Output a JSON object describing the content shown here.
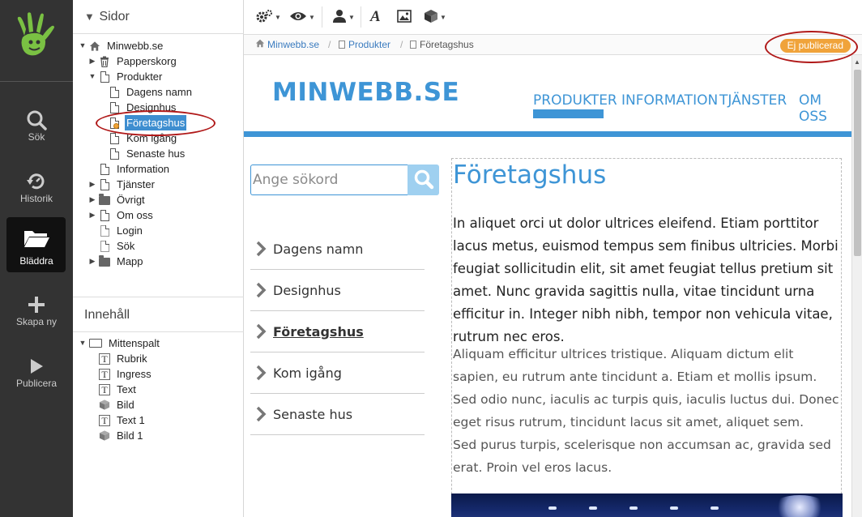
{
  "rail": {
    "items": [
      {
        "label": "Sök",
        "icon": "search-icon"
      },
      {
        "label": "Historik",
        "icon": "history-icon"
      },
      {
        "label": "Bläddra",
        "icon": "folder-open-icon"
      },
      {
        "label": "Skapa ny",
        "icon": "plus-icon"
      },
      {
        "label": "Publicera",
        "icon": "play-icon"
      }
    ]
  },
  "pages_panel": {
    "title": "Sidor",
    "tree": [
      {
        "label": "Minwebb.se"
      },
      {
        "label": "Papperskorg"
      },
      {
        "label": "Produkter"
      },
      {
        "label": "Dagens namn"
      },
      {
        "label": "Designhus"
      },
      {
        "label": "Företagshus"
      },
      {
        "label": "Kom igång"
      },
      {
        "label": "Senaste hus"
      },
      {
        "label": "Information"
      },
      {
        "label": "Tjänster"
      },
      {
        "label": "Övrigt"
      },
      {
        "label": "Om oss"
      },
      {
        "label": "Login"
      },
      {
        "label": "Sök"
      },
      {
        "label": "Mapp"
      }
    ]
  },
  "content_panel": {
    "title": "Innehåll",
    "tree": [
      {
        "label": "Mittenspalt"
      },
      {
        "label": "Rubrik"
      },
      {
        "label": "Ingress"
      },
      {
        "label": "Text"
      },
      {
        "label": "Bild"
      },
      {
        "label": "Text 1"
      },
      {
        "label": "Bild 1"
      }
    ]
  },
  "toolbar": {
    "icons": [
      "gears-icon",
      "eye-icon",
      "user-icon",
      "font-icon",
      "image-icon",
      "cube-icon"
    ]
  },
  "breadcrumb": {
    "items": [
      "Minwebb.se",
      "Produkter",
      "Företagshus"
    ],
    "separator": "/"
  },
  "status_badge": "Ej publicerad",
  "site": {
    "logo": "MINWEBB.SE",
    "nav": [
      "PRODUKTER",
      "INFORMATION",
      "TJÄNSTER",
      "OM OSS"
    ],
    "search_placeholder": "Ange sökord",
    "side_links": [
      "Dagens namn",
      "Designhus",
      "Företagshus",
      "Kom igång",
      "Senaste hus"
    ],
    "title": "Företagshus",
    "ingress": "In aliquet orci ut dolor ultrices eleifend. Etiam porttitor lacus metus, euismod tempus sem finibus ultricies. Morbi feugiat sollicitudin elit, sit amet feugiat tellus pretium sit amet. Nunc gravida sagittis nulla, vitae tincidunt urna efficitur in. Integer nibh nibh, tempor non vehicula vitae, rutrum nec eros.",
    "body_1": "Aliquam efficitur ultrices tristique. Aliquam dictum elit sapien, eu rutrum ante tincidunt a. Etiam et mollis ipsum. Sed odio nunc, iaculis ac turpis quis, iaculis luctus dui. Donec eget risus rutrum, tincidunt lacus sit amet, aliquet sem.",
    "body_2": "Sed purus turpis, scelerisque non accumsan ac, gravida sed erat. Proin vel eros lacus."
  },
  "colors": {
    "accent": "#3e95d6",
    "rail_bg": "#333333",
    "badge": "#f0a33a",
    "selection": "#3e8ed0",
    "annotation": "#b01818"
  }
}
